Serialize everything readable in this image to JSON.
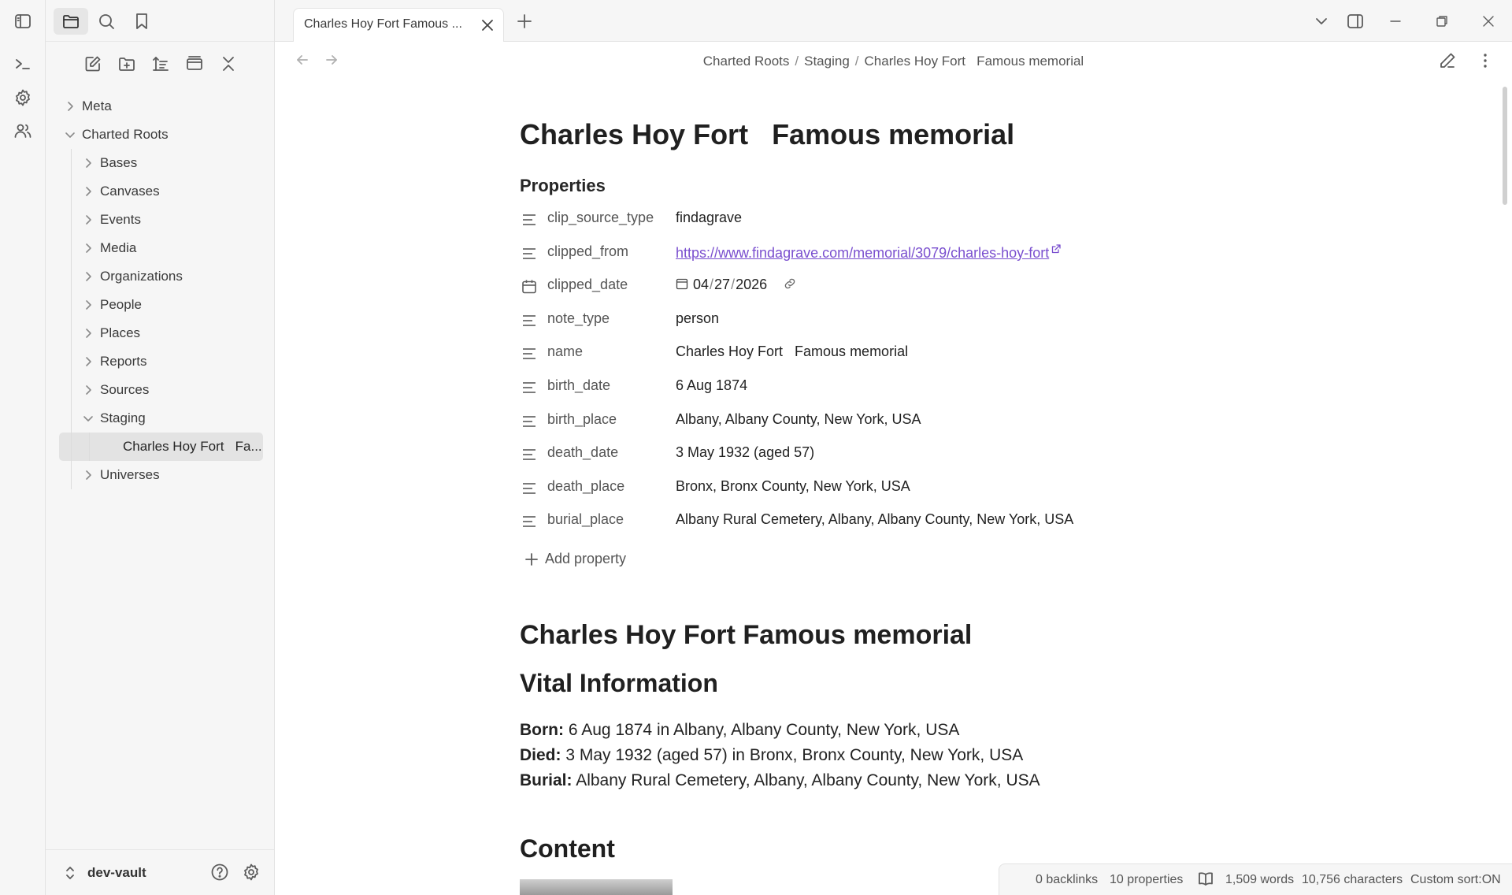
{
  "ribbon": {
    "icons": [
      "sidebar-toggle-icon",
      "terminal-icon",
      "gear-icon",
      "users-icon"
    ]
  },
  "sidebar": {
    "tabs": [
      "folder-icon",
      "search-icon",
      "bookmark-icon"
    ],
    "toolbar": [
      "new-note-icon",
      "new-folder-icon",
      "sort-icon",
      "collapse-view-icon",
      "collapse-all-icon"
    ],
    "tree": [
      {
        "label": "Meta",
        "level": 0,
        "expanded": false
      },
      {
        "label": "Charted Roots",
        "level": 0,
        "expanded": true
      },
      {
        "label": "Bases",
        "level": 1,
        "expanded": false
      },
      {
        "label": "Canvases",
        "level": 1,
        "expanded": false
      },
      {
        "label": "Events",
        "level": 1,
        "expanded": false
      },
      {
        "label": "Media",
        "level": 1,
        "expanded": false
      },
      {
        "label": "Organizations",
        "level": 1,
        "expanded": false
      },
      {
        "label": "People",
        "level": 1,
        "expanded": false
      },
      {
        "label": "Places",
        "level": 1,
        "expanded": false
      },
      {
        "label": "Reports",
        "level": 1,
        "expanded": false
      },
      {
        "label": "Sources",
        "level": 1,
        "expanded": false
      },
      {
        "label": "Staging",
        "level": 1,
        "expanded": true
      },
      {
        "label": "Charles Hoy Fort   Fa...",
        "level": 2,
        "file": true,
        "selected": true
      },
      {
        "label": "Universes",
        "level": 1,
        "expanded": false
      }
    ],
    "vault_name": "dev-vault"
  },
  "tabbar": {
    "active_tab": "Charles Hoy Fort Famous ..."
  },
  "breadcrumb": {
    "parts": [
      "Charted Roots",
      "Staging",
      "Charles Hoy Fort   Famous memorial"
    ]
  },
  "note": {
    "title": "Charles Hoy Fort   Famous memorial",
    "properties_heading": "Properties",
    "properties": [
      {
        "key": "clip_source_type",
        "value": "findagrave",
        "icon": "text-lines-icon"
      },
      {
        "key": "clipped_from",
        "value": "https://www.findagrave.com/memorial/3079/charles-hoy-fort",
        "icon": "text-lines-icon",
        "link": true
      },
      {
        "key": "clipped_date",
        "value": "",
        "icon": "calendar-icon",
        "date": true
      },
      {
        "key": "note_type",
        "value": "person",
        "icon": "text-lines-icon"
      },
      {
        "key": "name",
        "value": "Charles Hoy Fort   Famous memorial",
        "icon": "text-lines-icon"
      },
      {
        "key": "birth_date",
        "value": "6 Aug 1874",
        "icon": "text-lines-icon"
      },
      {
        "key": "birth_place",
        "value": "Albany, Albany County, New York, USA",
        "icon": "text-lines-icon"
      },
      {
        "key": "death_date",
        "value": "3 May 1932 (aged 57)",
        "icon": "text-lines-icon"
      },
      {
        "key": "death_place",
        "value": "Bronx, Bronx County, New York, USA",
        "icon": "text-lines-icon"
      },
      {
        "key": "burial_place",
        "value": "Albany Rural Cemetery, Albany, Albany County, New York, USA",
        "icon": "text-lines-icon"
      }
    ],
    "clipped_date": {
      "month": "04",
      "day": "27",
      "year": "2026"
    },
    "add_property": "Add property",
    "heading_main": "Charles Hoy Fort Famous memorial",
    "heading_vital": "Vital Information",
    "vital": [
      {
        "label": "Born:",
        "text": " 6 Aug 1874 in Albany, Albany County, New York, USA"
      },
      {
        "label": "Died:",
        "text": " 3 May 1932 (aged 57) in Bronx, Bronx County, New York, USA"
      },
      {
        "label": "Burial:",
        "text": " Albany Rural Cemetery, Albany, Albany County, New York, USA"
      }
    ],
    "heading_content": "Content"
  },
  "status": {
    "backlinks": "0 backlinks",
    "properties": "10 properties",
    "words": "1,509 words",
    "characters": "10,756 characters",
    "sort": "Custom sort:ON"
  }
}
